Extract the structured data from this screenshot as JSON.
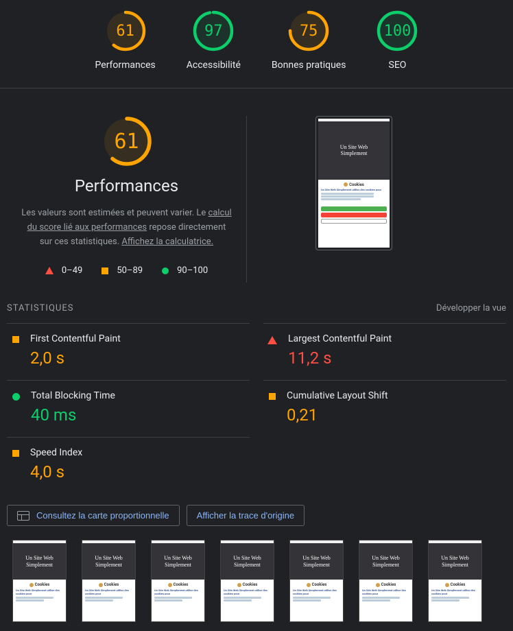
{
  "gauges": [
    {
      "score": 61,
      "label": "Performances",
      "color": "orange"
    },
    {
      "score": 97,
      "label": "Accessibilité",
      "color": "green"
    },
    {
      "score": 75,
      "label": "Bonnes pratiques",
      "color": "orange"
    },
    {
      "score": 100,
      "label": "SEO",
      "color": "green"
    }
  ],
  "perf": {
    "score": 61,
    "title": "Performances",
    "desc_prefix": "Les valeurs sont estimées et peuvent varier. Le ",
    "desc_link1": "calcul du score lié aux performances",
    "desc_mid": " repose directement sur ces statistiques. ",
    "desc_link2": "Affichez la calculatrice."
  },
  "legend": {
    "r0": "0–49",
    "r1": "50–89",
    "r2": "90–100"
  },
  "stats": {
    "heading": "STATISTIQUES",
    "expand": "Développer la vue"
  },
  "metrics": {
    "fcp": {
      "name": "First Contentful Paint",
      "value": "2,0 s",
      "status": "average"
    },
    "lcp": {
      "name": "Largest Contentful Paint",
      "value": "11,2 s",
      "status": "fail"
    },
    "tbt": {
      "name": "Total Blocking Time",
      "value": "40 ms",
      "status": "pass"
    },
    "cls": {
      "name": "Cumulative Layout Shift",
      "value": "0,21",
      "status": "average"
    },
    "si": {
      "name": "Speed Index",
      "value": "4,0 s",
      "status": "average"
    }
  },
  "actions": {
    "treemap": "Consultez la carte proportionnelle",
    "trace": "Afficher la trace d'origine"
  },
  "thumb": {
    "title_l1": "Un Site Web",
    "title_l2": "Simplement",
    "modal_title": "Cookies",
    "modal_sub": "Un Site Web Simplement utilise des cookies pour"
  }
}
